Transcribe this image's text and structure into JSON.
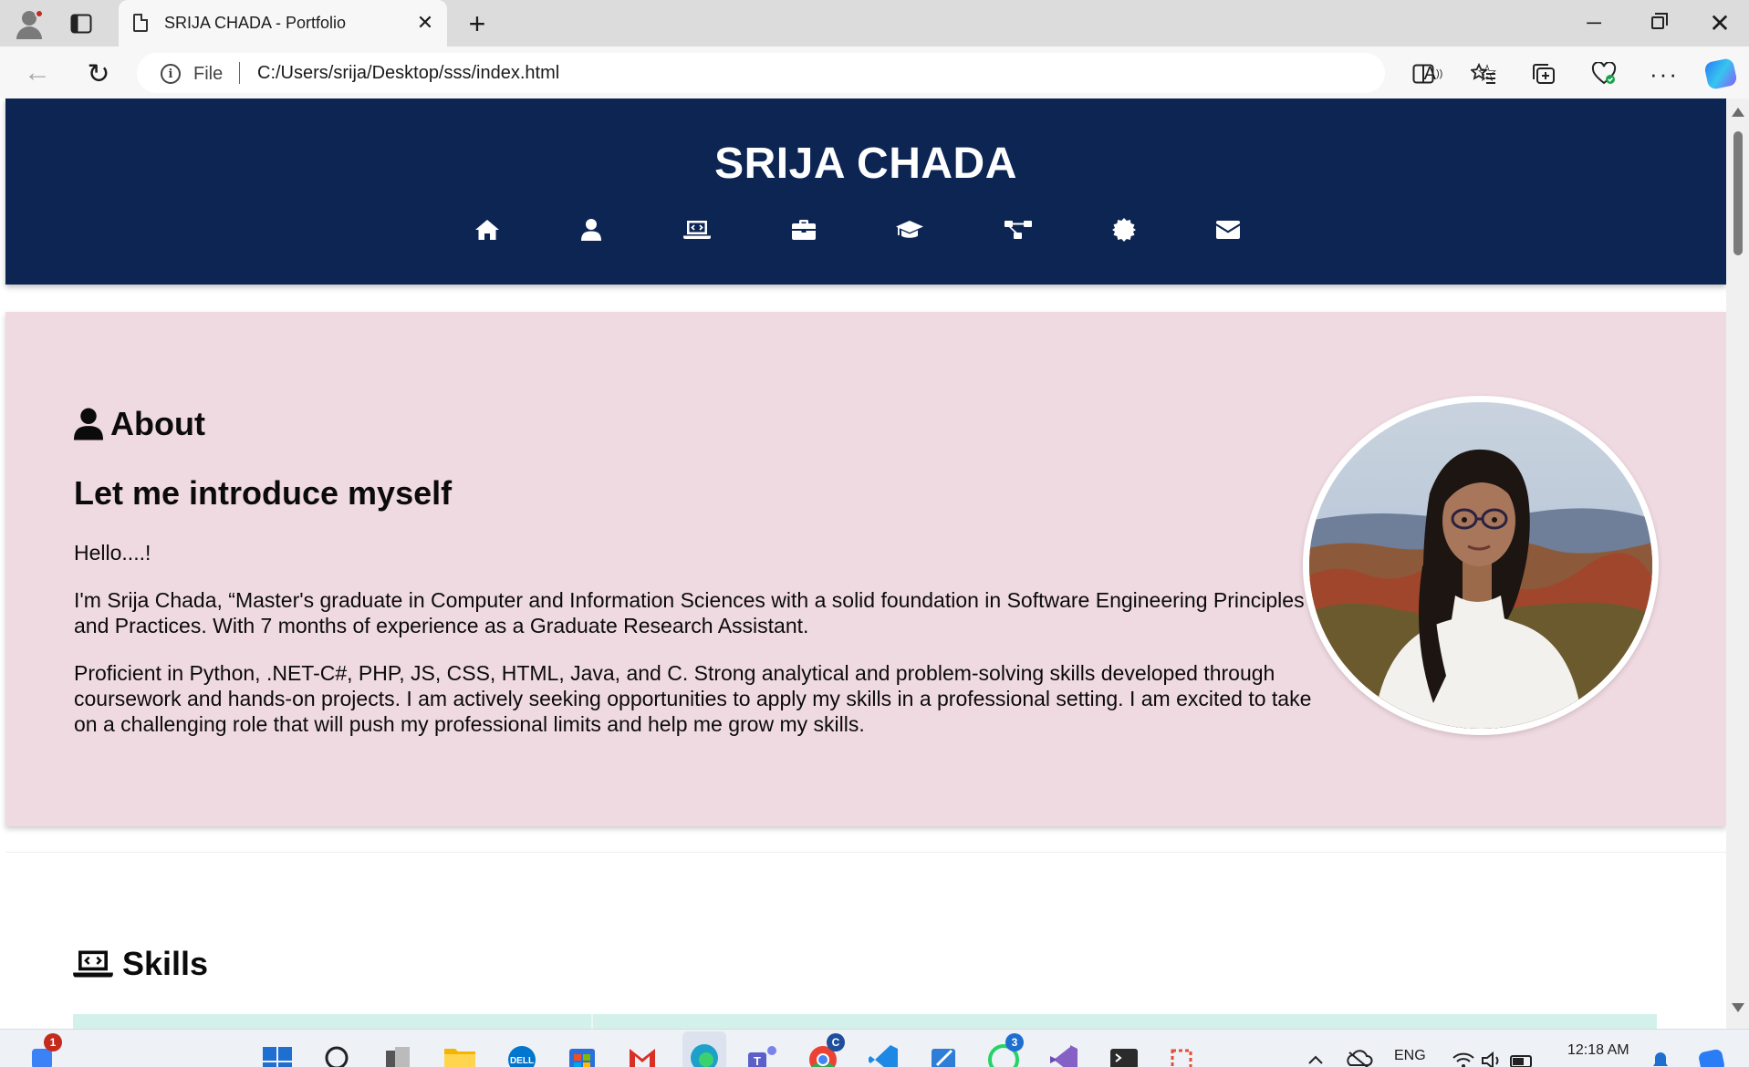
{
  "browser": {
    "tab_title": "SRIJA CHADA - Portfolio",
    "file_label": "File",
    "url": "C:/Users/srija/Desktop/sss/index.html"
  },
  "site": {
    "title": "SRIJA CHADA",
    "nav": [
      {
        "icon": "home-icon"
      },
      {
        "icon": "user-icon"
      },
      {
        "icon": "laptop-code-icon"
      },
      {
        "icon": "briefcase-icon"
      },
      {
        "icon": "graduation-cap-icon"
      },
      {
        "icon": "project-diagram-icon"
      },
      {
        "icon": "certificate-icon"
      },
      {
        "icon": "envelope-icon"
      }
    ]
  },
  "about": {
    "heading": "About",
    "subheading": "Let me introduce myself",
    "greeting": "Hello....!",
    "paragraph1": "I'm Srija Chada, “Master's graduate in Computer and Information Sciences with a solid foundation in Software Engineering Principles and Practices. With 7 months of experience as a Graduate Research Assistant.",
    "paragraph2": "Proficient in Python, .NET-C#, PHP, JS, CSS, HTML, Java, and C. Strong analytical and problem-solving skills developed through coursework and hands-on projects. I am actively seeking opportunities to apply my skills in a professional setting. I am excited to take on a challenging role that will push my professional limits and help me grow my skills."
  },
  "skills": {
    "heading": "Skills"
  },
  "taskbar": {
    "notification_count": "1",
    "chrome_badge": "C",
    "whatsapp_badge": "3",
    "language": "ENG",
    "time": "12:18 AM"
  },
  "colors": {
    "header_bg": "#0d2553",
    "about_bg": "#f0dae2",
    "skills_bar": "#d3f1ea"
  }
}
